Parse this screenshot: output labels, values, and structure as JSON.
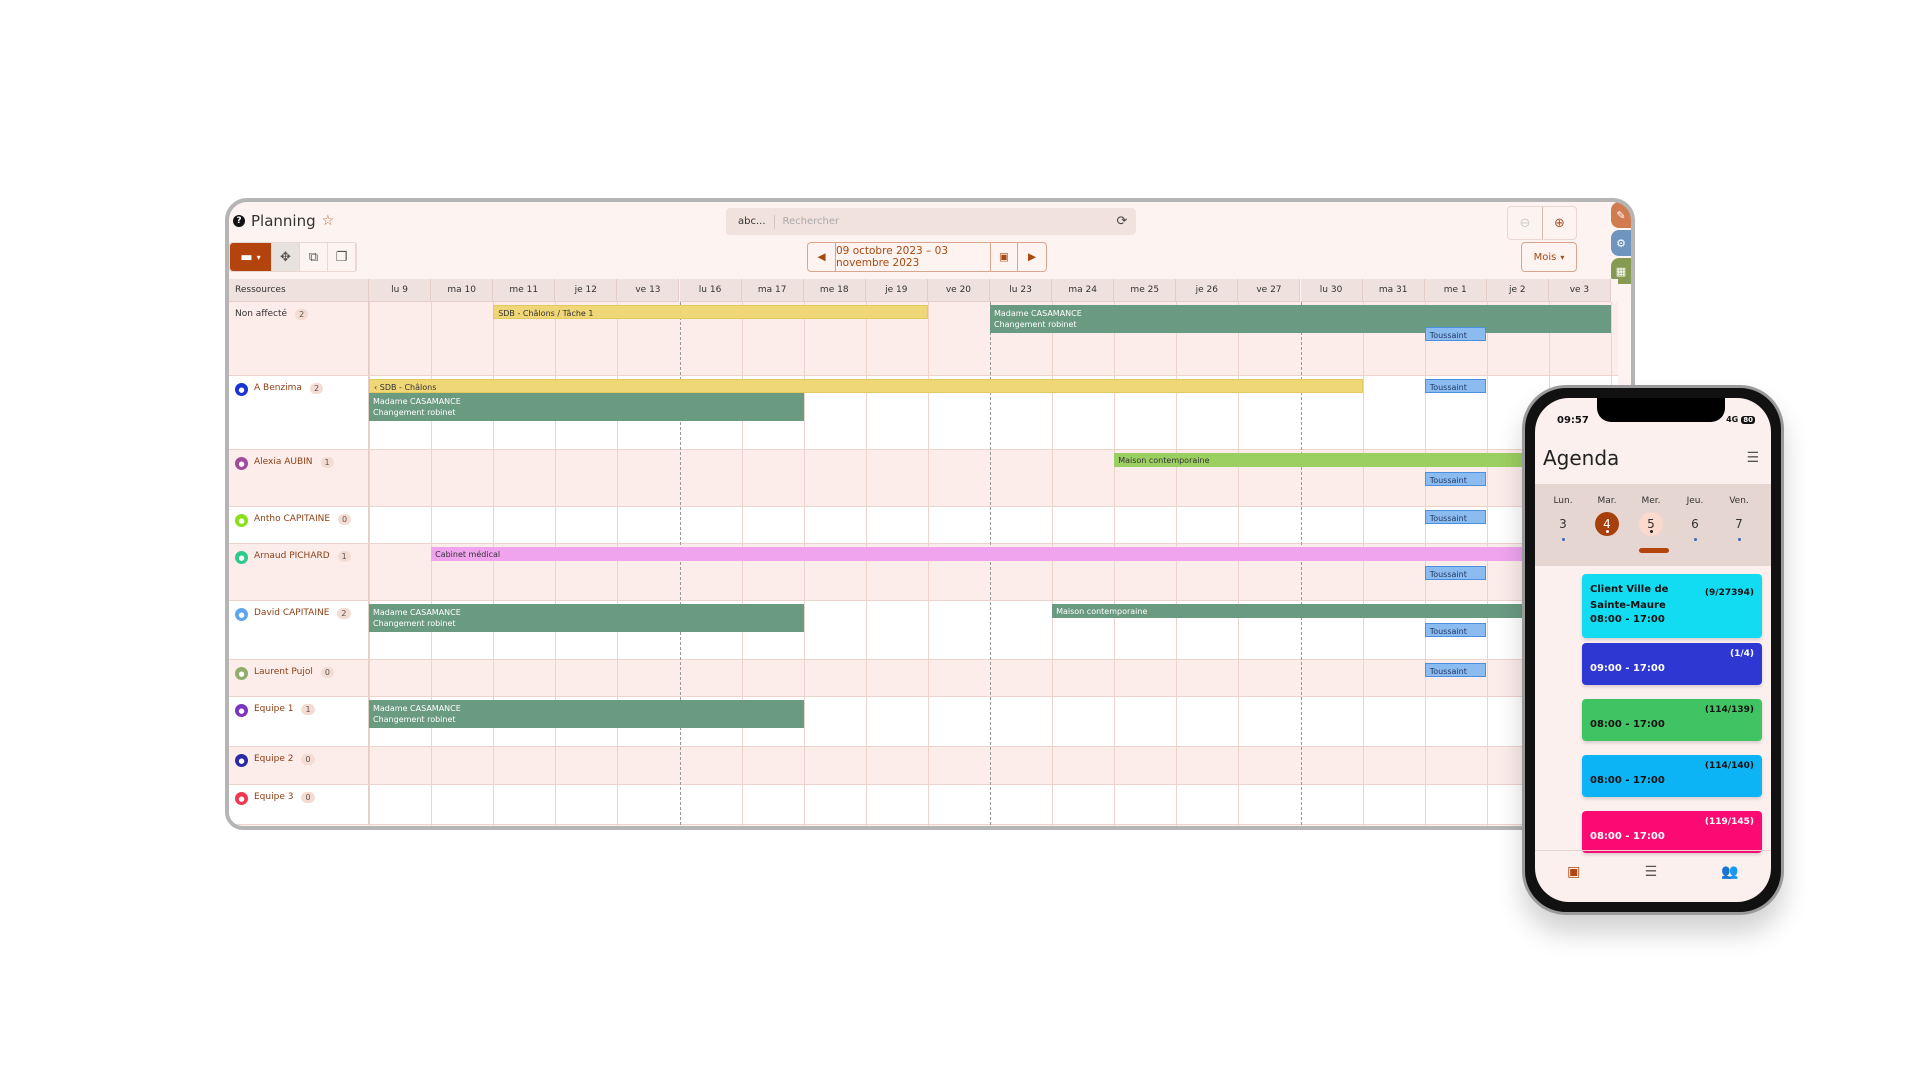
{
  "planning": {
    "title": "Planning",
    "search": {
      "mode": "abc...",
      "placeholder": "Rechercher"
    },
    "date_range": "09 octobre 2023 – 03 novembre 2023",
    "view_select": "Mois",
    "resources_header": "Ressources",
    "days": [
      "lu 9",
      "ma 10",
      "me 11",
      "je 12",
      "ve 13",
      "lu 16",
      "ma 17",
      "me 18",
      "je 19",
      "ve 20",
      "lu 23",
      "ma 24",
      "me 25",
      "je 26",
      "ve 27",
      "lu 30",
      "ma 31",
      "me 1",
      "je 2",
      "ve 3"
    ],
    "resources": [
      {
        "name": "Non affecté",
        "count": "2",
        "avatar_color": ""
      },
      {
        "name": "A Benzima",
        "count": "2",
        "avatar_color": "#1a32d6"
      },
      {
        "name": "Alexia AUBIN",
        "count": "1",
        "avatar_color": "#a24a9c"
      },
      {
        "name": "Antho CAPITAINE",
        "count": "0",
        "avatar_color": "#8be01c"
      },
      {
        "name": "Arnaud PICHARD",
        "count": "1",
        "avatar_color": "#2ec98d"
      },
      {
        "name": "David CAPITAINE",
        "count": "2",
        "avatar_color": "#5ea7f0"
      },
      {
        "name": "Laurent Pujol",
        "count": "0",
        "avatar_color": "#8fae6a"
      },
      {
        "name": "Equipe 1",
        "count": "1",
        "avatar_color": "#7a34c0"
      },
      {
        "name": "Equipe 2",
        "count": "0",
        "avatar_color": "#2a2aa8"
      },
      {
        "name": "Equipe 3",
        "count": "0",
        "avatar_color": "#f03850"
      }
    ],
    "events": [
      {
        "row": 0,
        "start": 2,
        "end": 9,
        "lane": 0,
        "color": "yellow",
        "line1": "SDB - Châlons / Tâche 1",
        "line2": ""
      },
      {
        "row": 0,
        "start": 10,
        "end": 20,
        "lane": 0,
        "color": "green",
        "line1": "Madame CASAMANCE",
        "line2": "Changement robinet"
      },
      {
        "row": 0,
        "start": 17,
        "end": 18,
        "lane": 2,
        "color": "blue",
        "line1": "Toussaint",
        "line2": ""
      },
      {
        "row": 1,
        "start": 0,
        "end": 16,
        "lane": 0,
        "color": "yellow",
        "line1": "‹ SDB - Châlons",
        "line2": ""
      },
      {
        "row": 1,
        "start": 0,
        "end": 7,
        "lane": 1,
        "color": "green",
        "line1": "Madame CASAMANCE",
        "line2": "Changement robinet"
      },
      {
        "row": 1,
        "start": 17,
        "end": 18,
        "lane": 0,
        "color": "blue",
        "line1": "Toussaint",
        "line2": ""
      },
      {
        "row": 2,
        "start": 12,
        "end": 20,
        "lane": 0,
        "color": "lime",
        "line1": "Maison contemporaine",
        "line2": ""
      },
      {
        "row": 2,
        "start": 17,
        "end": 18,
        "lane": 1,
        "color": "blue",
        "line1": "Toussaint",
        "line2": ""
      },
      {
        "row": 3,
        "start": 17,
        "end": 18,
        "lane": 0,
        "color": "blue",
        "line1": "Toussaint",
        "line2": ""
      },
      {
        "row": 4,
        "start": 1,
        "end": 20,
        "lane": 0,
        "color": "pinkbar",
        "line1": "Cabinet médical",
        "line2": ""
      },
      {
        "row": 4,
        "start": 17,
        "end": 18,
        "lane": 1,
        "color": "blue",
        "line1": "Toussaint",
        "line2": ""
      },
      {
        "row": 5,
        "start": 0,
        "end": 7,
        "lane": 0,
        "color": "green",
        "line1": "Madame CASAMANCE",
        "line2": "Changement robinet"
      },
      {
        "row": 5,
        "start": 11,
        "end": 20,
        "lane": 0,
        "color": "green",
        "line1": "Maison contemporaine",
        "line2": ""
      },
      {
        "row": 5,
        "start": 17,
        "end": 18,
        "lane": 1,
        "color": "blue",
        "line1": "Toussaint",
        "line2": ""
      },
      {
        "row": 6,
        "start": 17,
        "end": 18,
        "lane": 0,
        "color": "blue",
        "line1": "Toussaint",
        "line2": ""
      },
      {
        "row": 7,
        "start": 0,
        "end": 7,
        "lane": 0,
        "color": "green",
        "line1": "Madame CASAMANCE",
        "line2": "Changement robinet"
      }
    ]
  },
  "phone": {
    "time": "09:57",
    "network": "4G",
    "battery": "80",
    "title": "Agenda",
    "days": [
      {
        "label": "Lun.",
        "num": "3",
        "state": ""
      },
      {
        "label": "Mar.",
        "num": "4",
        "state": "sel"
      },
      {
        "label": "Mer.",
        "num": "5",
        "state": "today"
      },
      {
        "label": "Jeu.",
        "num": "6",
        "state": ""
      },
      {
        "label": "Ven.",
        "num": "7",
        "state": ""
      }
    ],
    "events": [
      {
        "title": "Client Ville de Sainte-Maure",
        "count": "(9/27394)",
        "time": "08:00 - 17:00",
        "color": "#12dcf2",
        "text": "#111"
      },
      {
        "title": "",
        "count": "(1/4)",
        "time": "09:00 - 17:00",
        "color": "#2f37d2",
        "text": "#fff"
      },
      {
        "title": "",
        "count": "(114/139)",
        "time": "08:00 - 17:00",
        "color": "#40c463",
        "text": "#111"
      },
      {
        "title": "",
        "count": "(114/140)",
        "time": "08:00 - 17:00",
        "color": "#0db4f5",
        "text": "#111"
      },
      {
        "title": "",
        "count": "(119/145)",
        "time": "08:00 - 17:00",
        "color": "#fb0a73",
        "text": "#fff"
      }
    ]
  }
}
